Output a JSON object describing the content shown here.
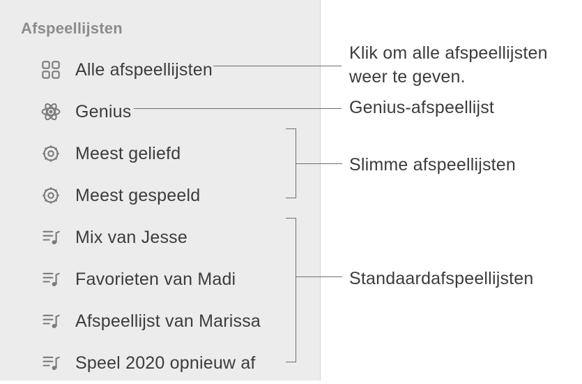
{
  "sidebar": {
    "header": "Afspeellijsten",
    "items": [
      {
        "icon": "grid-icon",
        "label": "Alle afspeellijsten"
      },
      {
        "icon": "atom-icon",
        "label": "Genius"
      },
      {
        "icon": "gear-icon",
        "label": "Meest geliefd"
      },
      {
        "icon": "gear-icon",
        "label": "Meest gespeeld"
      },
      {
        "icon": "playlist-icon",
        "label": "Mix van Jesse"
      },
      {
        "icon": "playlist-icon",
        "label": "Favorieten van Madi"
      },
      {
        "icon": "playlist-icon",
        "label": "Afspeellijst van Marissa"
      },
      {
        "icon": "playlist-icon",
        "label": "Speel 2020 opnieuw af"
      }
    ]
  },
  "callouts": {
    "c1": "Klik om alle afspeellijsten weer te geven.",
    "c2": "Genius-afspeellijst",
    "c3": "Slimme afspeellijsten",
    "c4": "Standaardafspeellijsten"
  }
}
